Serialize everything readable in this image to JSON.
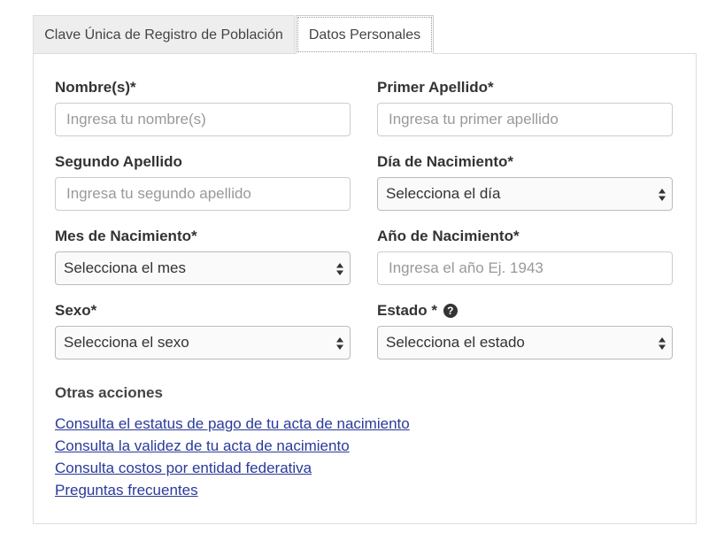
{
  "tabs": [
    {
      "label": "Clave Única de Registro de Población",
      "active": false
    },
    {
      "label": "Datos Personales",
      "active": true
    }
  ],
  "form": {
    "nombre": {
      "label": "Nombre(s)*",
      "placeholder": "Ingresa tu nombre(s)"
    },
    "primer_apellido": {
      "label": "Primer Apellido*",
      "placeholder": "Ingresa tu primer apellido"
    },
    "segundo_apellido": {
      "label": "Segundo Apellido",
      "placeholder": "Ingresa tu segundo apellido"
    },
    "dia": {
      "label": "Día de Nacimiento*",
      "selected": "Selecciona el día"
    },
    "mes": {
      "label": "Mes de Nacimiento*",
      "selected": "Selecciona el mes"
    },
    "anio": {
      "label": "Año de Nacimiento*",
      "placeholder": "Ingresa el año Ej. 1943"
    },
    "sexo": {
      "label": "Sexo*",
      "selected": "Selecciona el sexo"
    },
    "estado": {
      "label": "Estado *",
      "selected": "Selecciona el estado",
      "help_glyph": "?"
    }
  },
  "otras_acciones": {
    "title": "Otras acciones",
    "links": [
      "Consulta el estatus de pago de tu acta de nacimiento",
      "Consulta la validez de tu acta de nacimiento",
      "Consulta costos por entidad federativa",
      "Preguntas frecuentes"
    ]
  },
  "colors": {
    "link": "#2a3a9a",
    "label": "#333333",
    "border": "#cccccc"
  },
  "icons": {
    "help": "question-circle-icon",
    "select": "select-arrows-icon"
  }
}
